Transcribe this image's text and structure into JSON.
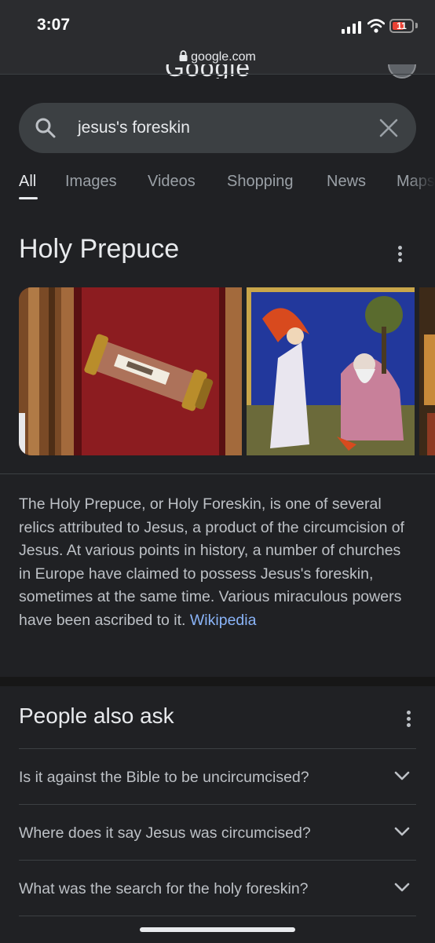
{
  "status": {
    "time": "3:07",
    "battery": "11",
    "url": "google.com"
  },
  "search": {
    "query": "jesus's foreskin"
  },
  "tabs": [
    {
      "label": "All"
    },
    {
      "label": "Images"
    },
    {
      "label": "Videos"
    },
    {
      "label": "Shopping"
    },
    {
      "label": "News"
    },
    {
      "label": "Maps"
    }
  ],
  "knowledge": {
    "title": "Holy Prepuce",
    "description": "The Holy Prepuce, or Holy Foreskin, is one of several relics attributed to Jesus, a product of the circumcision of Jesus. At various points in history, a number of churches in Europe have claimed to possess Jesus's foreskin, sometimes at the same time. Various miraculous powers have been ascribed to it.",
    "source": "Wikipedia"
  },
  "paa": {
    "title": "People also ask",
    "questions": [
      "Is it against the Bible to be uncircumcised?",
      "Where does it say Jesus was circumcised?",
      "What was the search for the holy foreskin?"
    ]
  },
  "colors": {
    "background": "#202124",
    "link": "#8ab4f8",
    "battery_low": "#e94235"
  }
}
